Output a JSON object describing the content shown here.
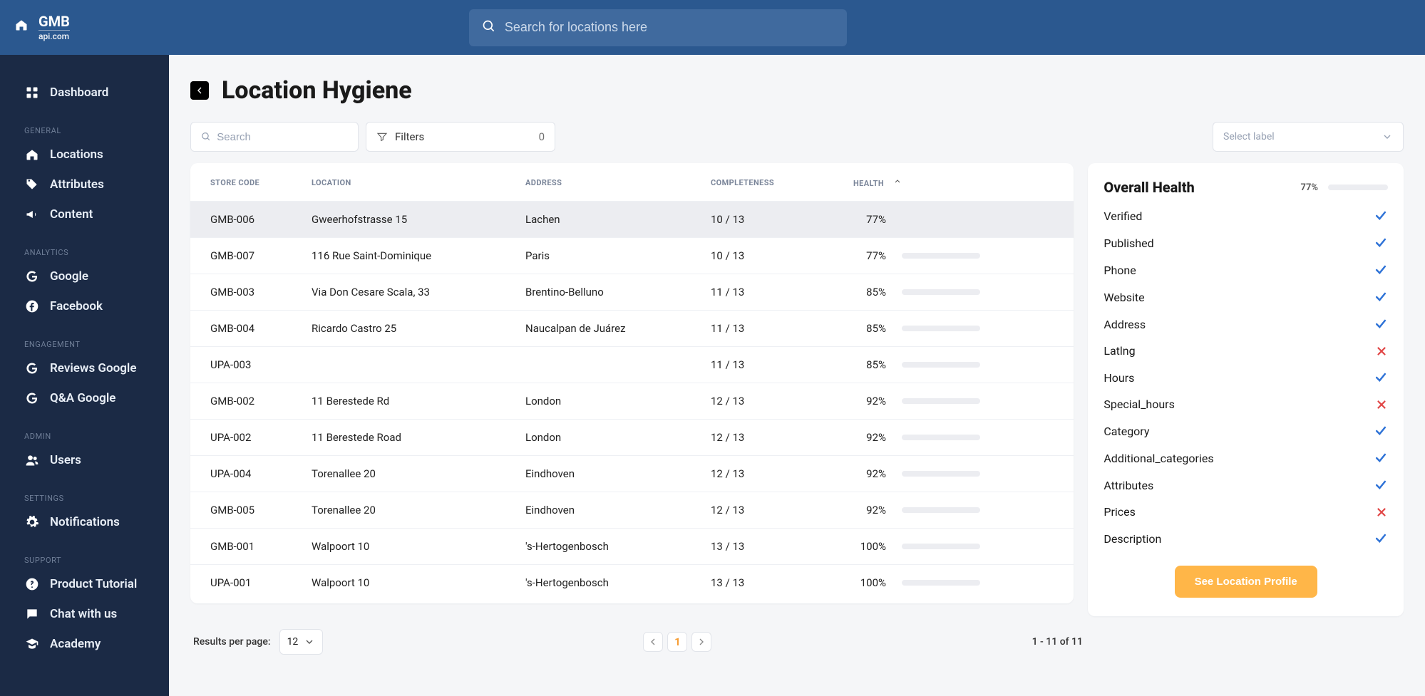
{
  "brand": {
    "name": "GMB",
    "sub": "api.com"
  },
  "search": {
    "placeholder": "Search for locations here"
  },
  "sidebar": {
    "top": [
      {
        "label": "Dashboard"
      }
    ],
    "sections": [
      {
        "title": "GENERAL",
        "items": [
          {
            "label": "Locations",
            "icon": "home"
          },
          {
            "label": "Attributes",
            "icon": "tag"
          },
          {
            "label": "Content",
            "icon": "megaphone"
          }
        ]
      },
      {
        "title": "ANALYTICS",
        "items": [
          {
            "label": "Google",
            "icon": "google"
          },
          {
            "label": "Facebook",
            "icon": "facebook"
          }
        ]
      },
      {
        "title": "ENGAGEMENT",
        "items": [
          {
            "label": "Reviews Google",
            "icon": "google"
          },
          {
            "label": "Q&A Google",
            "icon": "google"
          }
        ]
      },
      {
        "title": "ADMIN",
        "items": [
          {
            "label": "Users",
            "icon": "users"
          }
        ]
      },
      {
        "title": "SETTINGS",
        "items": [
          {
            "label": "Notifications",
            "icon": "gear"
          }
        ]
      },
      {
        "title": "SUPPORT",
        "items": [
          {
            "label": "Product Tutorial",
            "icon": "help"
          },
          {
            "label": "Chat with us",
            "icon": "chat"
          },
          {
            "label": "Academy",
            "icon": "academy"
          }
        ]
      }
    ]
  },
  "page": {
    "title": "Location Hygiene",
    "search_placeholder": "Search",
    "filters_label": "Filters",
    "filters_count": "0",
    "select_label_placeholder": "Select label"
  },
  "table": {
    "columns": {
      "store_code": "STORE CODE",
      "location": "LOCATION",
      "address": "ADDRESS",
      "completeness": "COMPLETENESS",
      "health": "HEALTH"
    },
    "rows": [
      {
        "code": "GMB-006",
        "location": "Gweerhofstrasse 15",
        "address": "Lachen",
        "completeness": "10 / 13",
        "health_pct": "77%",
        "health_val": 77,
        "color": "#9acb33",
        "selected": true
      },
      {
        "code": "GMB-007",
        "location": "116 Rue Saint-Dominique",
        "address": "Paris",
        "completeness": "10 / 13",
        "health_pct": "77%",
        "health_val": 77,
        "color": "#9acb33"
      },
      {
        "code": "GMB-003",
        "location": "Via Don Cesare Scala, 33",
        "address": "Brentino-Belluno",
        "completeness": "11 / 13",
        "health_pct": "85%",
        "health_val": 85,
        "color": "#55c78b"
      },
      {
        "code": "GMB-004",
        "location": "Ricardo Castro 25",
        "address": "Naucalpan de Juárez",
        "completeness": "11 / 13",
        "health_pct": "85%",
        "health_val": 85,
        "color": "#55c78b"
      },
      {
        "code": "UPA-003",
        "location": "",
        "address": "",
        "completeness": "11 / 13",
        "health_pct": "85%",
        "health_val": 85,
        "color": "#55c78b"
      },
      {
        "code": "GMB-002",
        "location": "11 Berestede Rd",
        "address": "London",
        "completeness": "12 / 13",
        "health_pct": "92%",
        "health_val": 92,
        "color": "#3fc57a"
      },
      {
        "code": "UPA-002",
        "location": "11 Berestede Road",
        "address": "London",
        "completeness": "12 / 13",
        "health_pct": "92%",
        "health_val": 92,
        "color": "#3fc57a"
      },
      {
        "code": "UPA-004",
        "location": "Torenallee 20",
        "address": "Eindhoven",
        "completeness": "12 / 13",
        "health_pct": "92%",
        "health_val": 92,
        "color": "#3fc57a"
      },
      {
        "code": "GMB-005",
        "location": "Torenallee 20",
        "address": "Eindhoven",
        "completeness": "12 / 13",
        "health_pct": "92%",
        "health_val": 92,
        "color": "#3fc57a"
      },
      {
        "code": "GMB-001",
        "location": "Walpoort 10",
        "address": "'s-Hertogenbosch",
        "completeness": "13 / 13",
        "health_pct": "100%",
        "health_val": 100,
        "color": "#2dbd68"
      },
      {
        "code": "UPA-001",
        "location": "Walpoort 10",
        "address": "'s-Hertogenbosch",
        "completeness": "13 / 13",
        "health_pct": "100%",
        "health_val": 100,
        "color": "#2dbd68"
      }
    ]
  },
  "paging": {
    "rpp_label": "Results per page:",
    "rpp_value": "12",
    "current_page": "1",
    "range": "1 - 11 of 11"
  },
  "health_panel": {
    "title": "Overall Health",
    "pct": "77%",
    "pct_val": 77,
    "items": [
      {
        "label": "Verified",
        "ok": true
      },
      {
        "label": "Published",
        "ok": true
      },
      {
        "label": "Phone",
        "ok": true
      },
      {
        "label": "Website",
        "ok": true
      },
      {
        "label": "Address",
        "ok": true
      },
      {
        "label": "Latlng",
        "ok": false
      },
      {
        "label": "Hours",
        "ok": true
      },
      {
        "label": "Special_hours",
        "ok": false
      },
      {
        "label": "Category",
        "ok": true
      },
      {
        "label": "Additional_categories",
        "ok": true
      },
      {
        "label": "Attributes",
        "ok": true
      },
      {
        "label": "Prices",
        "ok": false
      },
      {
        "label": "Description",
        "ok": true
      }
    ],
    "button": "See Location Profile"
  }
}
